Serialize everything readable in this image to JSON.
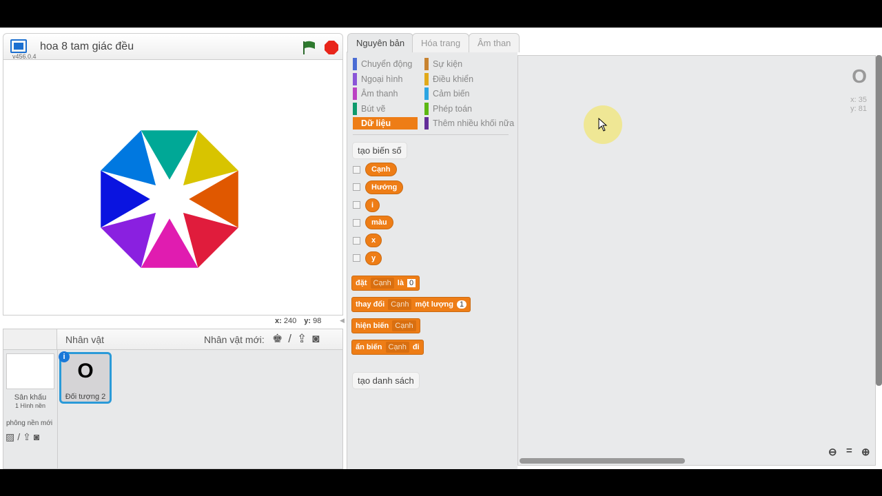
{
  "project": {
    "title": "hoa 8 tam giác đều",
    "version": "v456.0.4"
  },
  "stage": {
    "mouse_x_label": "x:",
    "mouse_x": "240",
    "mouse_y_label": "y:",
    "mouse_y": "98",
    "petal_colors": [
      "#00a896",
      "#d8c400",
      "#e05800",
      "#e01c3c",
      "#e01cb0",
      "#8a20e0",
      "#0a14e0",
      "#0078e0"
    ]
  },
  "tabs": [
    "Nguyên bản",
    "Hóa trang",
    "Âm than"
  ],
  "categories": [
    {
      "label": "Chuyển động",
      "color": "#4a6cd4"
    },
    {
      "label": "Sự kiện",
      "color": "#c88330"
    },
    {
      "label": "Ngoại hình",
      "color": "#8a55d7"
    },
    {
      "label": "Điều khiển",
      "color": "#e1a91a"
    },
    {
      "label": "Âm thanh",
      "color": "#bb42c3"
    },
    {
      "label": "Cảm biến",
      "color": "#2ca5e2"
    },
    {
      "label": "Bút vẽ",
      "color": "#0e9a6c"
    },
    {
      "label": "Phép toán",
      "color": "#5cb712"
    },
    {
      "label": "Dữ liệu",
      "color": "#ee7d16"
    },
    {
      "label": "Thêm nhiều khối nữa",
      "color": "#632d99"
    }
  ],
  "make_variable": "tạo biến số",
  "variables": [
    "Cạnh",
    "Hướng",
    "i",
    "màu",
    "x",
    "y"
  ],
  "blocks": {
    "set": {
      "a": "đặt",
      "var": "Cạnh",
      "b": "là",
      "val": "0"
    },
    "change": {
      "a": "thay đổi",
      "var": "Cạnh",
      "b": "một lượng",
      "val": "1"
    },
    "show": {
      "a": "hiện biến",
      "var": "Cạnh"
    },
    "hide": {
      "a": "ẩn biến",
      "var": "Cạnh",
      "b": "đi"
    }
  },
  "make_list": "tạo danh sách",
  "sprites_panel": {
    "header": "Nhân vật",
    "new_sprite": "Nhân vật mới:",
    "stage_label": "Sân khấu",
    "backdrops": "1 Hình nền",
    "new_backdrop": "phông nền mới",
    "sprite": {
      "name": "Đối tượng 2",
      "costume": "O"
    }
  },
  "script_area": {
    "sprite_costume": "O",
    "x_label": "x:",
    "x": "35",
    "y_label": "y:",
    "y": "81"
  }
}
